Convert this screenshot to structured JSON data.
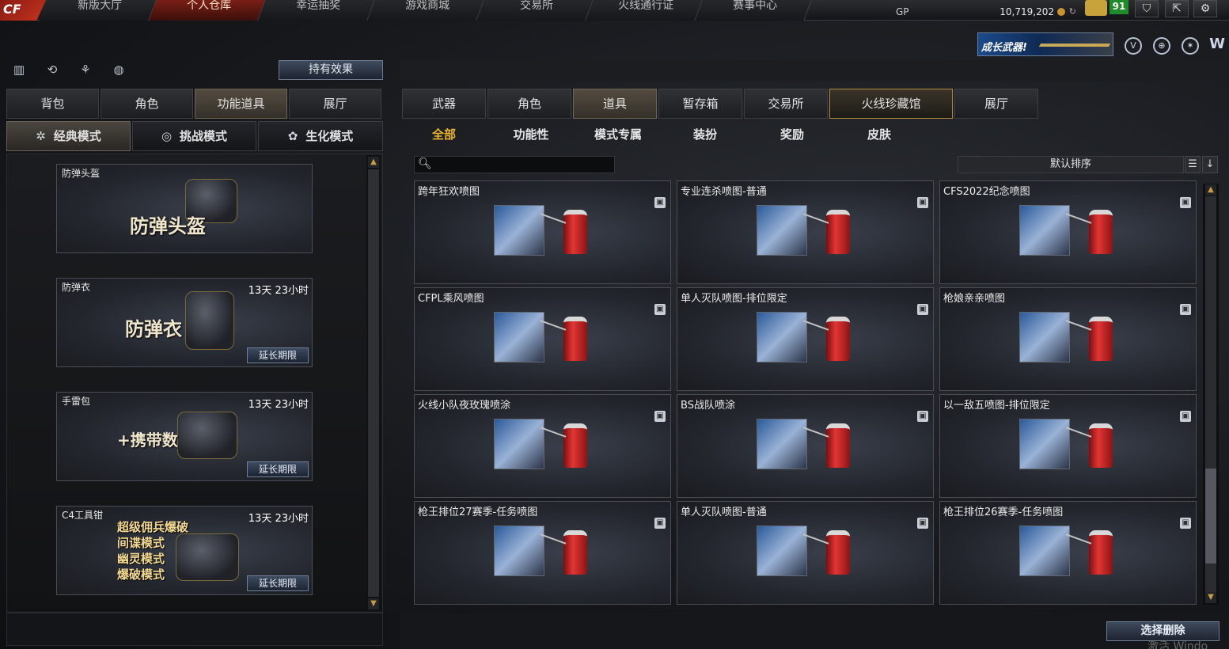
{
  "topnav": [
    "新版大厅",
    "个人仓库",
    "幸运抽奖",
    "游戏商城",
    "交易所",
    "火线通行证",
    "赛事中心"
  ],
  "topnav_active": 1,
  "currency": {
    "label": "GP",
    "value": "10,719,202"
  },
  "level": "91",
  "banner_text": "成长武器!",
  "left": {
    "effect_button": "持有效果",
    "tabs": [
      "背包",
      "角色",
      "功能道具",
      "展厅"
    ],
    "tabs_active": 2,
    "modes": [
      "经典模式",
      "挑战模式",
      "生化模式"
    ],
    "modes_active": 0,
    "items": [
      {
        "name": "防弹头盔",
        "big": "防弹头盔",
        "time": "",
        "ext": ""
      },
      {
        "name": "防弹衣",
        "big": "防弹衣",
        "time": "13天 23小时",
        "ext": "延长期限"
      },
      {
        "name": "手雷包",
        "big": "+携带数",
        "time": "13天 23小时",
        "ext": "延长期限"
      },
      {
        "name": "C4工具钳",
        "big": "",
        "time": "13天 23小时",
        "ext": "延长期限",
        "lines": [
          "超级佣兵爆破",
          "间谍模式",
          "幽灵模式",
          "爆破模式"
        ]
      }
    ]
  },
  "right": {
    "tabs": [
      "武器",
      "角色",
      "道具",
      "暂存箱",
      "交易所",
      "火线珍藏馆",
      "展厅"
    ],
    "tabs_active": 2,
    "tabs_highlight": 5,
    "subtabs": [
      "全部",
      "功能性",
      "模式专属",
      "装扮",
      "奖励",
      "皮肤"
    ],
    "subtabs_active": 0,
    "sort_label": "默认排序",
    "cards": [
      {
        "name": "跨年狂欢喷图"
      },
      {
        "name": "专业连杀喷图-普通"
      },
      {
        "name": "CFS2022纪念喷图"
      },
      {
        "name": "CFPL乘风喷图"
      },
      {
        "name": "单人灭队喷图-排位限定"
      },
      {
        "name": "枪娘亲亲喷图"
      },
      {
        "name": "火线小队夜玫瑰喷涂"
      },
      {
        "name": "BS战队喷涂"
      },
      {
        "name": "以一敌五喷图-排位限定"
      },
      {
        "name": "枪王排位27赛季-任务喷图"
      },
      {
        "name": "单人灭队喷图-普通"
      },
      {
        "name": "枪王排位26赛季-任务喷图"
      }
    ],
    "delete_button": "选择删除"
  },
  "watermark": "激活 Windo"
}
